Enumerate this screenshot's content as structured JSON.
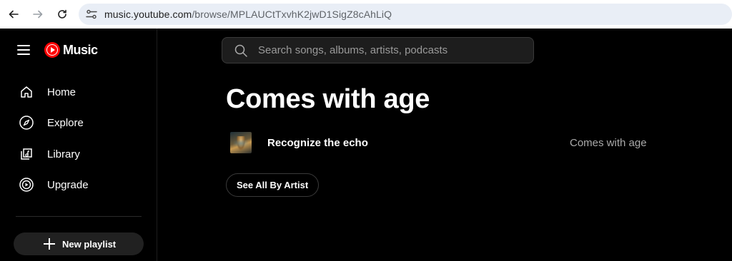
{
  "browser": {
    "url_host": "music.youtube.com",
    "url_path": "/browse/MPLAUCtTxvhK2jwD1SigZ8cAhLiQ",
    "back_icon": "arrow-left-icon",
    "forward_icon": "arrow-right-icon",
    "reload_icon": "reload-icon",
    "site_info_icon": "tune-icon"
  },
  "sidebar": {
    "brand": "Music",
    "items": [
      {
        "label": "Home",
        "icon": "home-icon"
      },
      {
        "label": "Explore",
        "icon": "compass-icon"
      },
      {
        "label": "Library",
        "icon": "library-icon"
      },
      {
        "label": "Upgrade",
        "icon": "upgrade-icon"
      }
    ],
    "new_playlist_label": "New playlist"
  },
  "search": {
    "placeholder": "Search songs, albums, artists, podcasts"
  },
  "main": {
    "title": "Comes with age",
    "tracks": [
      {
        "title": "Recognize the echo",
        "album": "Comes with age"
      }
    ],
    "see_all_label": "See All By Artist"
  },
  "colors": {
    "brand_red": "#ff0000",
    "background": "#000000",
    "secondary_text": "#aaaaaa"
  }
}
